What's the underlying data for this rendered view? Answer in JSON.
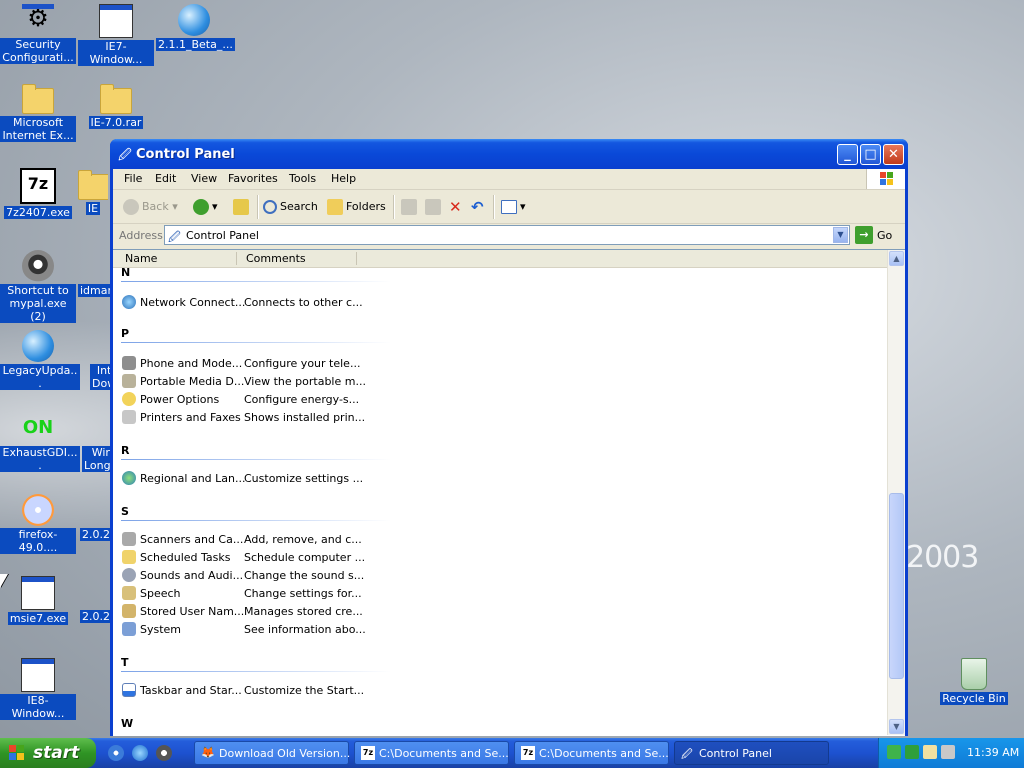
{
  "desktop": {
    "wallpaper_text": "2003",
    "icons": [
      {
        "label": "Security Configurati..."
      },
      {
        "label": "IE7-Window..."
      },
      {
        "label": "2.1.1_Beta_..."
      },
      {
        "label": "Microsoft Internet Ex..."
      },
      {
        "label": "IE-7.0.rar"
      },
      {
        "label": "7z2407.exe"
      },
      {
        "label": "IE"
      },
      {
        "label": "Shortcut to mypal.exe (2)"
      },
      {
        "label": "idman"
      },
      {
        "label": "LegacyUpda..."
      },
      {
        "label": "Int Dow"
      },
      {
        "label": "ExhaustGDI...."
      },
      {
        "label": "Wir Longh"
      },
      {
        "label": "firefox-49.0...."
      },
      {
        "label": "2.0.2"
      },
      {
        "label": "msie7.exe"
      },
      {
        "label": "2.0.2"
      },
      {
        "label": "IE8-Window..."
      },
      {
        "label": "Recycle Bin"
      }
    ]
  },
  "window": {
    "title": "Control Panel",
    "menu": [
      "File",
      "Edit",
      "View",
      "Favorites",
      "Tools",
      "Help"
    ],
    "toolbar": {
      "back": "Back",
      "search": "Search",
      "folders": "Folders"
    },
    "address": {
      "label": "Address",
      "value": "Control Panel",
      "go": "Go"
    },
    "columns": {
      "name": "Name",
      "comments": "Comments"
    },
    "groups": [
      {
        "letter": "N",
        "items": [
          {
            "name": "Network Connect...",
            "comment": "Connects to other c..."
          }
        ]
      },
      {
        "letter": "P",
        "items": [
          {
            "name": "Phone and Mode...",
            "comment": "Configure your tele..."
          },
          {
            "name": "Portable Media D...",
            "comment": "View the portable m..."
          },
          {
            "name": "Power Options",
            "comment": "Configure energy-s..."
          },
          {
            "name": "Printers and Faxes",
            "comment": "Shows installed prin..."
          }
        ]
      },
      {
        "letter": "R",
        "items": [
          {
            "name": "Regional and Lan...",
            "comment": "Customize settings ..."
          }
        ]
      },
      {
        "letter": "S",
        "items": [
          {
            "name": "Scanners and Ca...",
            "comment": "Add, remove, and c..."
          },
          {
            "name": "Scheduled Tasks",
            "comment": "Schedule computer ..."
          },
          {
            "name": "Sounds and Audi...",
            "comment": "Change the sound s..."
          },
          {
            "name": "Speech",
            "comment": "Change settings for..."
          },
          {
            "name": "Stored User Nam...",
            "comment": "Manages stored cre..."
          },
          {
            "name": "System",
            "comment": "See information abo..."
          }
        ]
      },
      {
        "letter": "T",
        "items": [
          {
            "name": "Taskbar and Star...",
            "comment": "Customize the Start..."
          }
        ]
      },
      {
        "letter": "W",
        "items": []
      }
    ]
  },
  "taskbar": {
    "start": "start",
    "tasks": [
      {
        "label": "Download Old Version..."
      },
      {
        "label": "C:\\Documents and Se..."
      },
      {
        "label": "C:\\Documents and Se..."
      },
      {
        "label": "Control Panel"
      }
    ],
    "clock": "11:39 AM"
  },
  "colors": {
    "xp_blue": "#0a49d8",
    "start_green": "#2f9424",
    "selection_blue": "#0b4bbf"
  }
}
